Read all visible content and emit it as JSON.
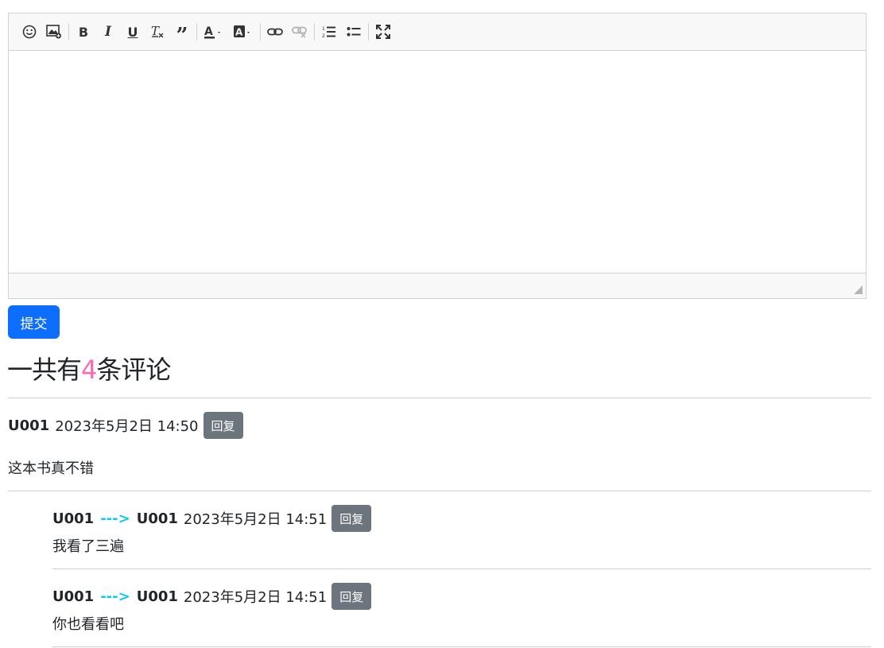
{
  "toolbar": {
    "buttons": [
      {
        "name": "emoji-icon"
      },
      {
        "name": "insert-image-icon"
      },
      {
        "name": "bold-icon",
        "glyph": "B"
      },
      {
        "name": "italic-icon",
        "glyph": "I"
      },
      {
        "name": "underline-icon",
        "glyph": "U"
      },
      {
        "name": "remove-format-icon"
      },
      {
        "name": "blockquote-icon"
      },
      {
        "name": "text-color-icon"
      },
      {
        "name": "background-color-icon"
      },
      {
        "name": "link-icon"
      },
      {
        "name": "unlink-icon"
      },
      {
        "name": "ordered-list-icon"
      },
      {
        "name": "unordered-list-icon"
      },
      {
        "name": "fullscreen-icon"
      }
    ]
  },
  "submit": {
    "label": "提交"
  },
  "heading": {
    "prefix": "一共有",
    "count": "4",
    "suffix": "条评论",
    "count_color": "#ff69b4"
  },
  "reply_label": "回复",
  "comments": [
    {
      "user": "U001",
      "time": "2023年5月2日 14:50",
      "content": "这本书真不错"
    }
  ],
  "replies": [
    {
      "from": "U001",
      "arrow": "--->",
      "to": "U001",
      "time": "2023年5月2日 14:51",
      "content": "我看了三遍"
    },
    {
      "from": "U001",
      "arrow": "--->",
      "to": "U001",
      "time": "2023年5月2日 14:51",
      "content": "你也看看吧"
    }
  ],
  "colors": {
    "primary": "#0d6efd",
    "secondary": "#6c757d",
    "arrow": "#0dcaf0"
  }
}
